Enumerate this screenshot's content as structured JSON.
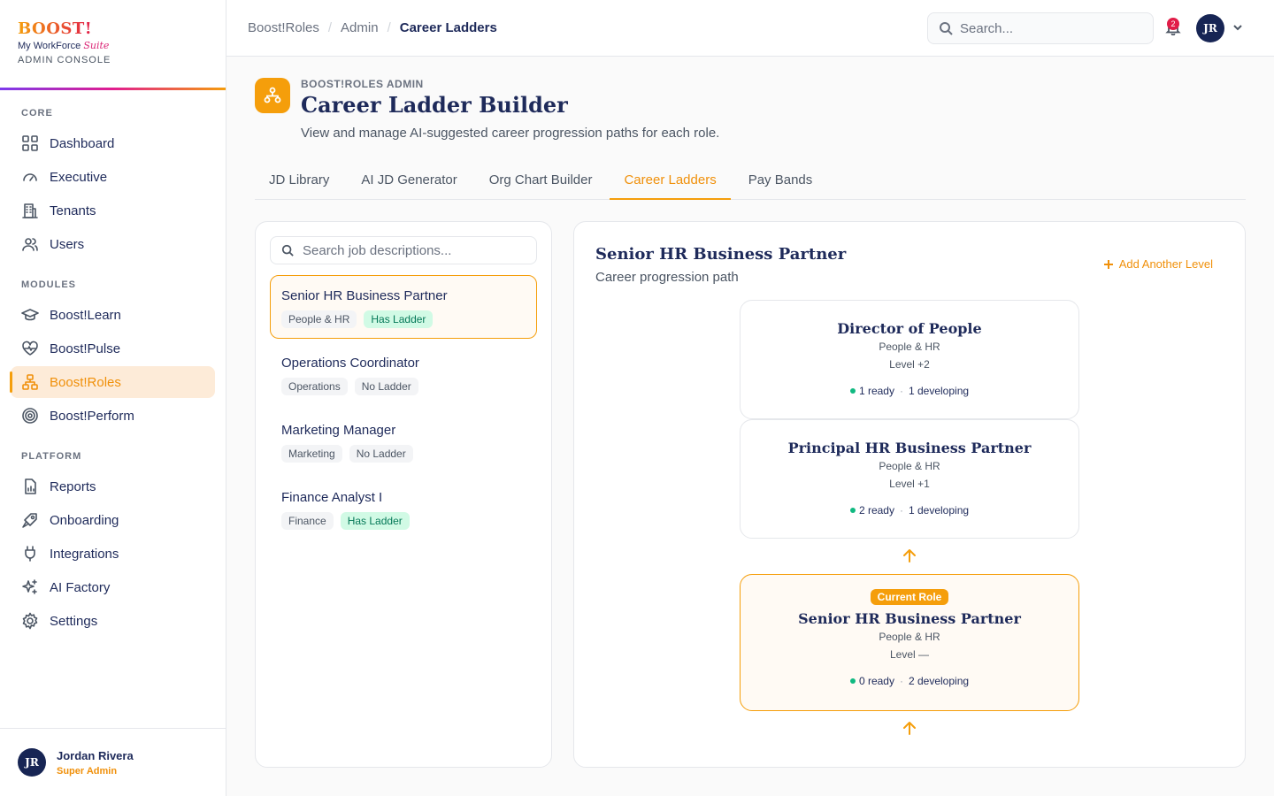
{
  "brand": {
    "logo": "BOOST!",
    "sub": "My WorkForce",
    "sub_suffix": "Suite",
    "console": "ADMIN CONSOLE"
  },
  "nav": {
    "core_heading": "CORE",
    "core": [
      {
        "label": "Dashboard",
        "icon": "grid-icon"
      },
      {
        "label": "Executive",
        "icon": "gauge-icon"
      },
      {
        "label": "Tenants",
        "icon": "building-icon"
      },
      {
        "label": "Users",
        "icon": "users-icon"
      }
    ],
    "modules_heading": "MODULES",
    "modules": [
      {
        "label": "Boost!Learn",
        "icon": "graduation-cap-icon"
      },
      {
        "label": "Boost!Pulse",
        "icon": "heart-pulse-icon"
      },
      {
        "label": "Boost!Roles",
        "icon": "org-chart-icon"
      },
      {
        "label": "Boost!Perform",
        "icon": "target-icon"
      }
    ],
    "platform_heading": "PLATFORM",
    "platform": [
      {
        "label": "Reports",
        "icon": "report-icon"
      },
      {
        "label": "Onboarding",
        "icon": "rocket-icon"
      },
      {
        "label": "Integrations",
        "icon": "plug-icon"
      },
      {
        "label": "AI Factory",
        "icon": "sparkles-icon"
      },
      {
        "label": "Settings",
        "icon": "gear-icon"
      }
    ]
  },
  "user": {
    "initials": "JR",
    "name": "Jordan Rivera",
    "role": "Super Admin"
  },
  "topbar": {
    "breadcrumb": [
      "Boost!Roles",
      "Admin",
      "Career Ladders"
    ],
    "search_placeholder": "Search...",
    "notifications": "2",
    "avatar": "JR"
  },
  "header": {
    "eyebrow": "BOOST!ROLES ADMIN",
    "title": "Career Ladder Builder",
    "description": "View and manage AI-suggested career progression paths for each role."
  },
  "tabs": [
    "JD Library",
    "AI JD Generator",
    "Org Chart Builder",
    "Career Ladders",
    "Pay Bands"
  ],
  "active_tab": "Career Ladders",
  "jd_list": {
    "search_placeholder": "Search job descriptions...",
    "items": [
      {
        "title": "Senior HR Business Partner",
        "dept": "People & HR",
        "status": "Has Ladder"
      },
      {
        "title": "Operations Coordinator",
        "dept": "Operations",
        "status": "No Ladder"
      },
      {
        "title": "Marketing Manager",
        "dept": "Marketing",
        "status": "No Ladder"
      },
      {
        "title": "Finance Analyst I",
        "dept": "Finance",
        "status": "Has Ladder"
      }
    ]
  },
  "ladder": {
    "title": "Senior HR Business Partner",
    "subtitle": "Career progression path",
    "add_label": "Add Another Level",
    "levels": [
      {
        "title": "Director of People",
        "dept": "People & HR",
        "level": "Level +2",
        "ready": "1 ready",
        "developing": "1 developing"
      },
      {
        "title": "Principal HR Business Partner",
        "dept": "People & HR",
        "level": "Level +1",
        "ready": "2 ready",
        "developing": "1 developing"
      },
      {
        "badge": "Current Role",
        "title": "Senior HR Business Partner",
        "dept": "People & HR",
        "level": "Level —",
        "ready": "0 ready",
        "developing": "2 developing"
      }
    ]
  },
  "colors": {
    "accent": "#f59e0b",
    "navy": "#1e2a5a",
    "success": "#10b981",
    "badge": "#e11d48"
  }
}
